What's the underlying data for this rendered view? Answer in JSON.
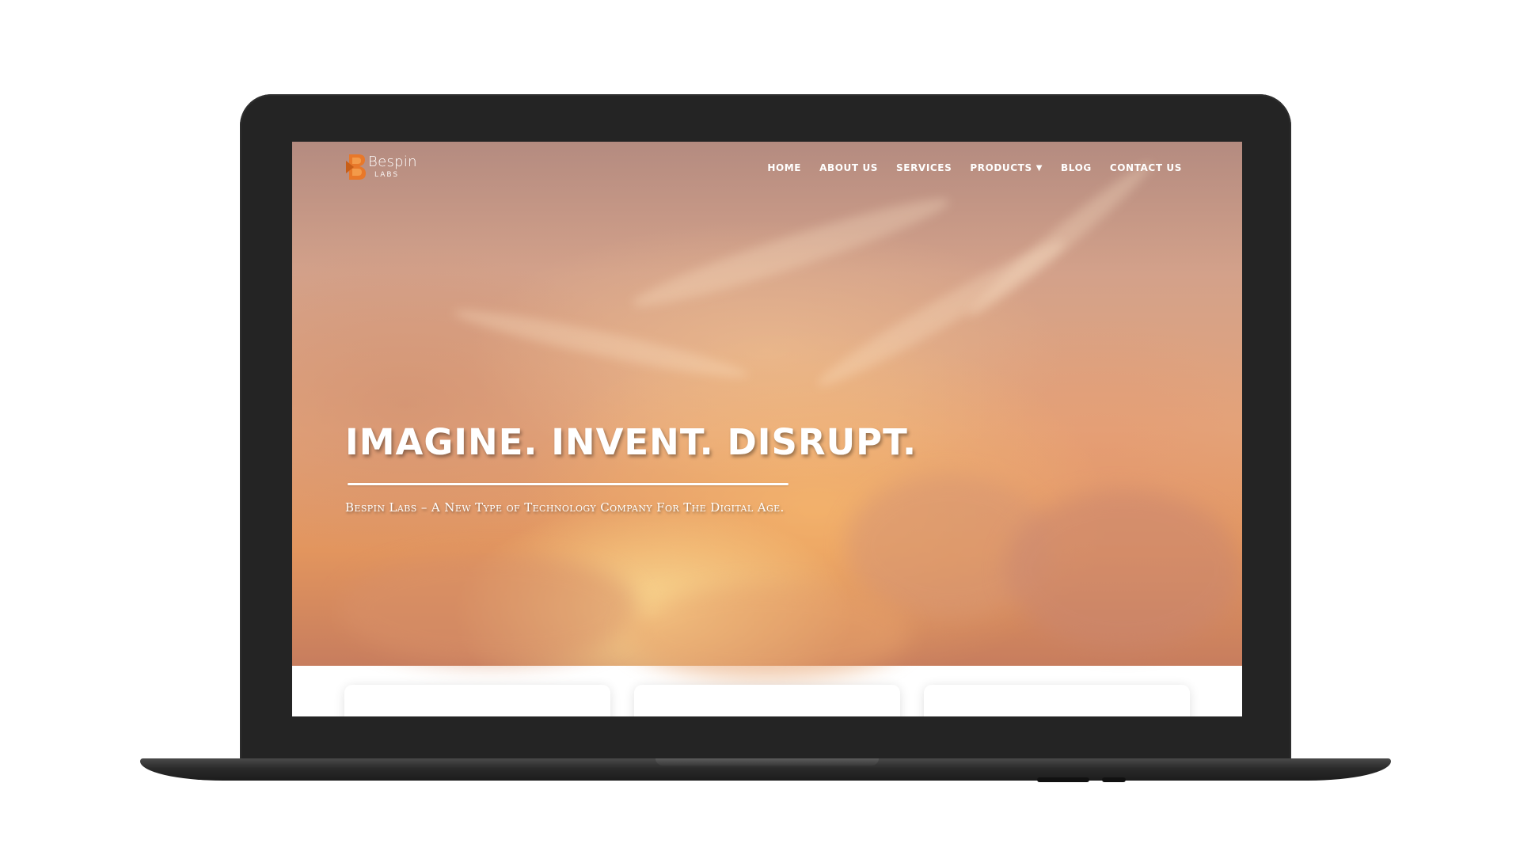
{
  "brand": {
    "name": "Bespin",
    "sub": "LABS",
    "accent_color": "#e8782a"
  },
  "nav": {
    "items": [
      {
        "label": "HOME"
      },
      {
        "label": "ABOUT US"
      },
      {
        "label": "SERVICES"
      },
      {
        "label": "PRODUCTS",
        "has_dropdown": true,
        "icon": "caret-down-icon"
      },
      {
        "label": "BLOG"
      },
      {
        "label": "CONTACT US"
      }
    ]
  },
  "hero": {
    "title": "IMAGINE. INVENT. DISRUPT.",
    "tagline": "Bespin Labs – A New Type of Technology Company For The Digital Age."
  }
}
